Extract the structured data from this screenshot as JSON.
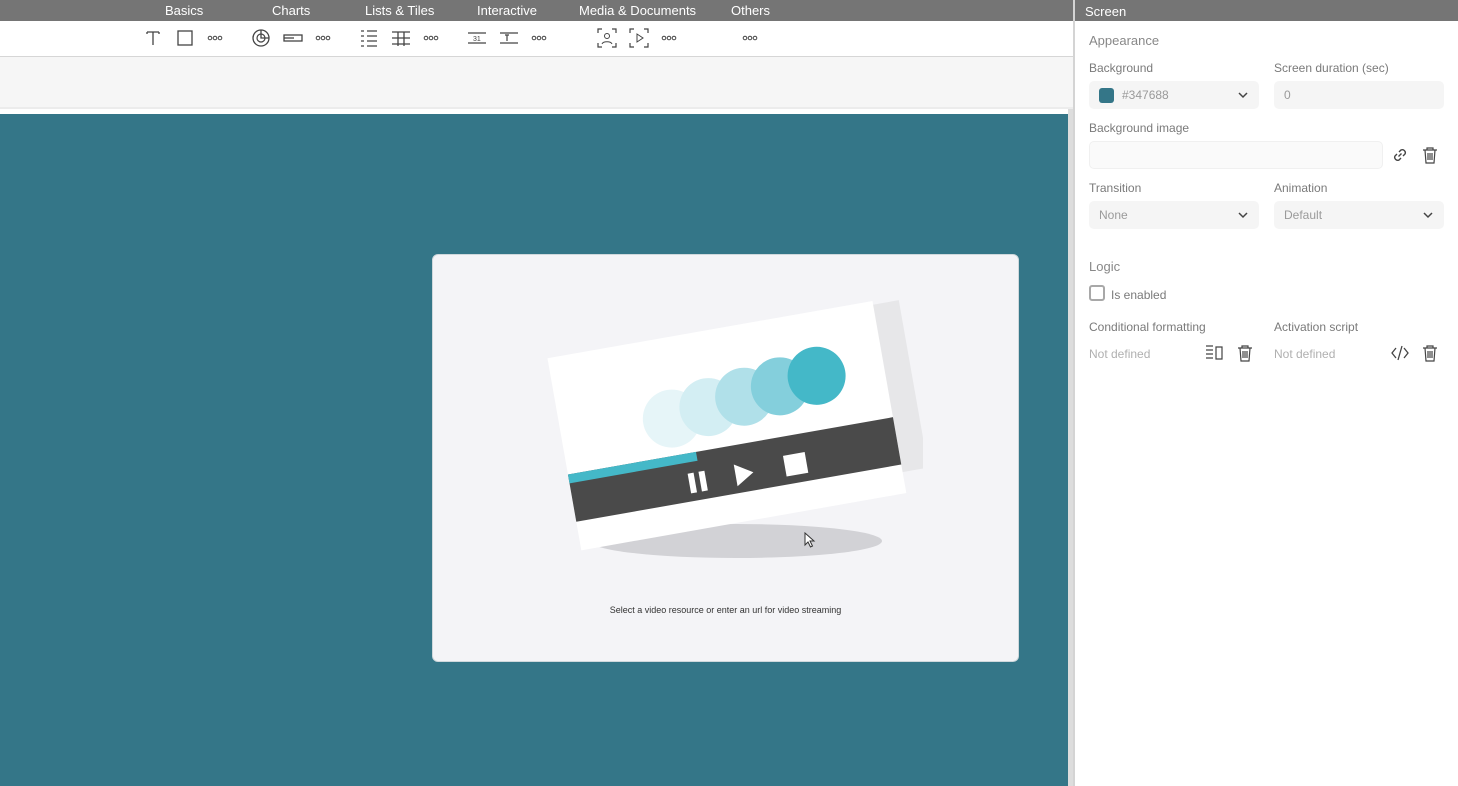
{
  "menu": {
    "categories": [
      "Basics",
      "Charts",
      "Lists & Tiles",
      "Interactive",
      "Media & Documents",
      "Others"
    ]
  },
  "toolbar": {
    "tools": [
      "text-icon",
      "rectangle-icon",
      "more-icon",
      "pie-chart-icon",
      "progress-bar-icon",
      "more-icon",
      "list-icon",
      "table-icon",
      "more-icon",
      "number-input-icon",
      "text-input-icon",
      "more-icon",
      "image-icon",
      "video-icon",
      "more-icon",
      "more-icon"
    ]
  },
  "canvas": {
    "background_color": "#347688",
    "video_widget": {
      "caption": "Select a video resource or enter an url for video streaming"
    }
  },
  "panel": {
    "title": "Screen",
    "appearance": {
      "section_title": "Appearance",
      "background_label": "Background",
      "background_value": "#347688",
      "background_color": "#347688",
      "screen_duration_label": "Screen duration (sec)",
      "screen_duration_value": "0",
      "background_image_label": "Background image",
      "background_image_value": "",
      "transition_label": "Transition",
      "transition_value": "None",
      "animation_label": "Animation",
      "animation_value": "Default"
    },
    "logic": {
      "section_title": "Logic",
      "is_enabled_label": "Is enabled",
      "conditional_formatting_label": "Conditional formatting",
      "conditional_formatting_value": "Not defined",
      "activation_script_label": "Activation script",
      "activation_script_value": "Not defined"
    }
  }
}
